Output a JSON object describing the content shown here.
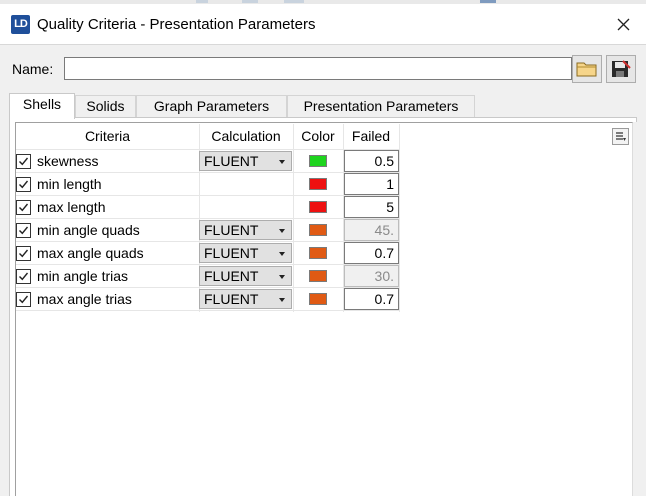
{
  "window": {
    "title": "Quality Criteria - Presentation Parameters",
    "icon_text": "LD"
  },
  "name_field": {
    "label": "Name:",
    "value": ""
  },
  "tabs": [
    {
      "label": "Shells",
      "active": true
    },
    {
      "label": "Solids",
      "active": false
    },
    {
      "label": "Graph Parameters",
      "active": false
    },
    {
      "label": "Presentation Parameters",
      "active": false
    }
  ],
  "table": {
    "headers": {
      "criteria": "Criteria",
      "calculation": "Calculation",
      "color": "Color",
      "failed": "Failed"
    },
    "rows": [
      {
        "checked": true,
        "criteria": "skewness",
        "calculation": "FLUENT",
        "color": "#1ed41e",
        "failed": "0.5",
        "failed_disabled": false
      },
      {
        "checked": true,
        "criteria": "min length",
        "calculation": "",
        "color": "#ee1111",
        "failed": "1",
        "failed_disabled": false
      },
      {
        "checked": true,
        "criteria": "max length",
        "calculation": "",
        "color": "#ee1111",
        "failed": "5",
        "failed_disabled": false
      },
      {
        "checked": true,
        "criteria": "min angle quads",
        "calculation": "FLUENT",
        "color": "#e05a14",
        "failed": "45.",
        "failed_disabled": true
      },
      {
        "checked": true,
        "criteria": "max angle quads",
        "calculation": "FLUENT",
        "color": "#e05a14",
        "failed": "0.7",
        "failed_disabled": false
      },
      {
        "checked": true,
        "criteria": "min angle trias",
        "calculation": "FLUENT",
        "color": "#e05a14",
        "failed": "30.",
        "failed_disabled": true
      },
      {
        "checked": true,
        "criteria": "max angle trias",
        "calculation": "FLUENT",
        "color": "#e05a14",
        "failed": "0.7",
        "failed_disabled": false
      }
    ]
  },
  "icons": {
    "close": "close-icon",
    "open": "folder-icon",
    "save": "save-icon",
    "columns": "column-menu-icon",
    "check": "check-icon",
    "dropdown": "chevron-down-icon"
  }
}
